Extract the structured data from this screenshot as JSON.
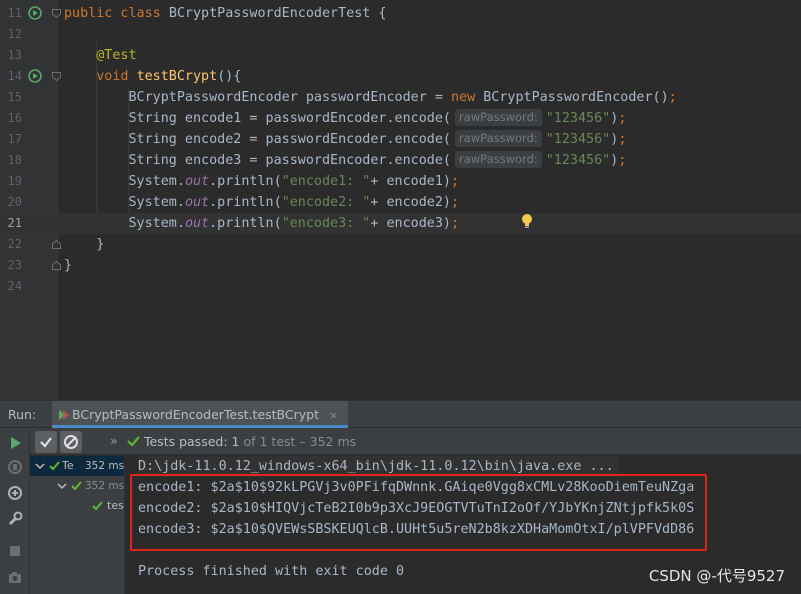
{
  "editor": {
    "lines": [
      {
        "n": "11",
        "tokens": [
          [
            "kw",
            "public class "
          ],
          [
            "plain",
            "BCryptPasswordEncoderTest {"
          ]
        ]
      },
      {
        "n": "12",
        "tokens": []
      },
      {
        "n": "13",
        "tokens": [
          [
            "an",
            "    @Test"
          ]
        ]
      },
      {
        "n": "14",
        "tokens": [
          [
            "kw",
            "    void "
          ],
          [
            "fn",
            "testBCrypt"
          ],
          [
            "plain",
            "(){"
          ]
        ]
      },
      {
        "n": "15",
        "tokens": [
          [
            "plain",
            "        BCryptPasswordEncoder passwordEncoder = "
          ],
          [
            "kw",
            "new "
          ],
          [
            "plain",
            "BCryptPasswordEncoder()"
          ],
          [
            "kw",
            ";"
          ]
        ]
      },
      {
        "n": "16",
        "tokens": [
          [
            "plain",
            "        String encode1 = passwordEncoder.encode("
          ],
          [
            "hint",
            "rawPassword:"
          ],
          [
            "str",
            "\"123456\""
          ],
          [
            "plain",
            ")"
          ],
          [
            "kw",
            ";"
          ]
        ]
      },
      {
        "n": "17",
        "tokens": [
          [
            "plain",
            "        String encode2 = passwordEncoder.encode("
          ],
          [
            "hint",
            "rawPassword:"
          ],
          [
            "str",
            "\"123456\""
          ],
          [
            "plain",
            ")"
          ],
          [
            "kw",
            ";"
          ]
        ]
      },
      {
        "n": "18",
        "tokens": [
          [
            "plain",
            "        String encode3 = passwordEncoder.encode("
          ],
          [
            "hint",
            "rawPassword:"
          ],
          [
            "str",
            "\"123456\""
          ],
          [
            "plain",
            ")"
          ],
          [
            "kw",
            ";"
          ]
        ]
      },
      {
        "n": "19",
        "tokens": [
          [
            "plain",
            "        System."
          ],
          [
            "it",
            "out"
          ],
          [
            "plain",
            ".println("
          ],
          [
            "str",
            "\"encode1: \""
          ],
          [
            "plain",
            "+ encode1)"
          ],
          [
            "kw",
            ";"
          ]
        ]
      },
      {
        "n": "20",
        "tokens": [
          [
            "plain",
            "        System."
          ],
          [
            "it",
            "out"
          ],
          [
            "plain",
            ".println("
          ],
          [
            "str",
            "\"encode2: \""
          ],
          [
            "plain",
            "+ encode2)"
          ],
          [
            "kw",
            ";"
          ]
        ]
      },
      {
        "n": "21",
        "tokens": [
          [
            "plain",
            "        System."
          ],
          [
            "it",
            "out"
          ],
          [
            "plain",
            ".println("
          ],
          [
            "str",
            "\"encode3: \""
          ],
          [
            "plain",
            "+ encode3)"
          ],
          [
            "kw",
            ";"
          ]
        ]
      },
      {
        "n": "22",
        "tokens": [
          [
            "plain",
            "    }"
          ]
        ]
      },
      {
        "n": "23",
        "tokens": [
          [
            "plain",
            "}"
          ]
        ]
      },
      {
        "n": "24",
        "tokens": []
      }
    ],
    "current_line": "21"
  },
  "run_panel": {
    "label": "Run:",
    "tab_title": "BCryptPasswordEncoderTest.testBCrypt",
    "tab_close": "×",
    "status_chevron": "»",
    "status_passed": "Tests passed:",
    "status_count": "1",
    "status_rest": "of 1 test – 352 ms",
    "tree": [
      {
        "label": "Te",
        "time": "352 ms"
      },
      {
        "label": "",
        "time": "352 ms"
      },
      {
        "label": "tes",
        "time": ""
      }
    ]
  },
  "console": {
    "command": "D:\\jdk-11.0.12_windows-x64_bin\\jdk-11.0.12\\bin\\java.exe ...",
    "outputs": [
      "encode1: $2a$10$92kLPGVj3v0PFifqDWnnk.GAiqe0Vgg8xCMLv28KooDiemTeuNZga",
      "encode2: $2a$10$HIQVjcTeB2I0b9p3XcJ9EOGTVTuTnI2oOf/YJbYKnjZNtjpfk5k0S",
      "encode3: $2a$10$QVEWsSBSKEUQlcB.UUHt5u5reN2b8kzXDHaMomOtxI/plVPFVdD86"
    ],
    "exit_message": "Process finished with exit code 0"
  },
  "watermark": "CSDN @-代号9527",
  "colors": {
    "keyword": "#cc7832",
    "method": "#ffc66d",
    "string": "#6a8759",
    "annotation": "#bbb529",
    "pass_green": "#5fb832",
    "highlight_box": "#e1251b"
  },
  "icons": [
    "run-gutter-icon",
    "intention-bulb-icon",
    "run-icon",
    "check-icon",
    "cancel-icon",
    "camera-icon",
    "gear-icon"
  ]
}
